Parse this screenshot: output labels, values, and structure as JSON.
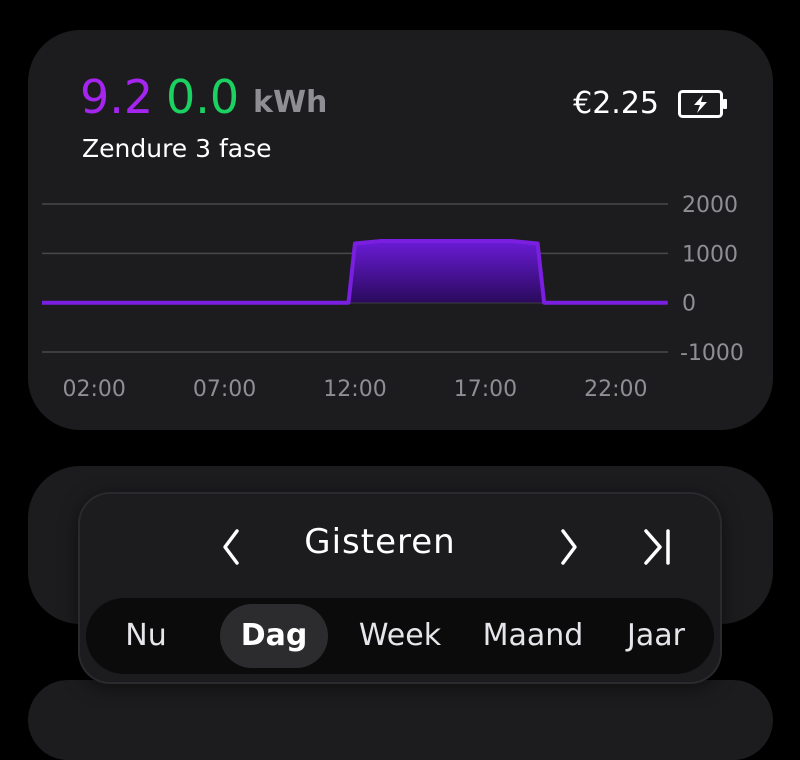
{
  "summary": {
    "value_primary": "9.2",
    "value_secondary": "0.0",
    "unit": "kWh",
    "device_name": "Zendure 3 fase",
    "price": "€2.25",
    "battery_icon": "battery-charging-icon",
    "colors": {
      "primary": "#a524f0",
      "secondary": "#1ad161"
    }
  },
  "chart_data": {
    "type": "area",
    "x": [
      "00:00",
      "11:45",
      "12:00",
      "13:00",
      "18:00",
      "19:00",
      "19:15",
      "23:59"
    ],
    "y": [
      0,
      0,
      1200,
      1250,
      1250,
      1200,
      0,
      0
    ],
    "xticks": [
      "02:00",
      "07:00",
      "12:00",
      "17:00",
      "22:00"
    ],
    "yticks": [
      "2000",
      "1000",
      "0",
      "-1000"
    ],
    "ylim": [
      -1000,
      2000
    ],
    "grid": true,
    "color": "#7a1fe0"
  },
  "navigation": {
    "period_label": "Gisteren",
    "prev_icon": "chevron-left-icon",
    "next_icon": "chevron-right-icon",
    "last_icon": "skip-to-end-icon",
    "tabs": [
      {
        "label": "Nu",
        "active": false
      },
      {
        "label": "Dag",
        "active": true
      },
      {
        "label": "Week",
        "active": false
      },
      {
        "label": "Maand",
        "active": false
      },
      {
        "label": "Jaar",
        "active": false
      }
    ]
  }
}
